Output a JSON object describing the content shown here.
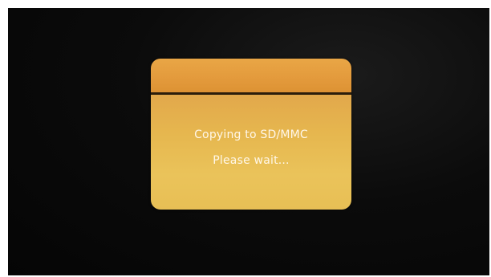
{
  "dialog": {
    "title": "",
    "message_line_1": "Copying to SD/MMC",
    "message_line_2": "Please wait..."
  },
  "colors": {
    "screen_background": "#080808",
    "dialog_header": "#e39a3c",
    "dialog_body": "#e8bb53",
    "dialog_divider": "#2b1d0b",
    "message_text": "#fff7e8"
  }
}
